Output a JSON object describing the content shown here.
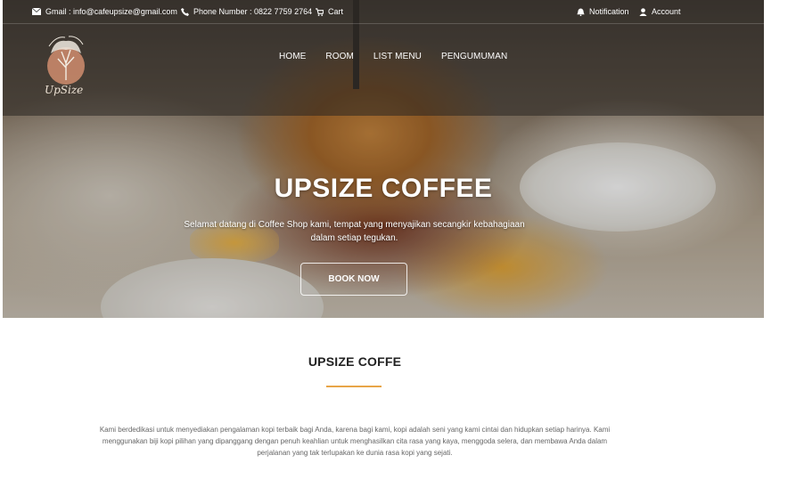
{
  "topbar": {
    "email": "Gmail : info@cafeupsize@gmail.com",
    "phone": "Phone Number : 0822 7759 2764",
    "cart": "Cart",
    "notification": "Notification",
    "account": "Account"
  },
  "icons": {
    "email": "envelope-icon",
    "phone": "phone-icon",
    "cart": "cart-icon",
    "notification": "bell-icon",
    "account": "user-icon"
  },
  "logo": {
    "text": "UpSize"
  },
  "nav": {
    "items": [
      {
        "label": "HOME"
      },
      {
        "label": "ROOM"
      },
      {
        "label": "LIST MENU"
      },
      {
        "label": "PENGUMUMAN"
      }
    ]
  },
  "hero": {
    "title": "UPSIZE COFFEE",
    "subtitle": "Selamat datang di Coffee Shop kami, tempat yang menyajikan secangkir kebahagiaan dalam setiap tegukan.",
    "button": "BOOK NOW"
  },
  "about": {
    "title": "UPSIZE COFFE",
    "text": "Kami berdedikasi untuk menyediakan pengalaman kopi terbaik bagi Anda, karena bagi kami, kopi adalah seni yang kami cintai dan hidupkan setiap harinya. Kami menggunakan biji kopi pilihan yang dipanggang dengan penuh keahlian untuk menghasilkan cita rasa yang kaya, menggoda selera, dan membawa Anda dalam perjalanan yang tak terlupakan ke dunia rasa kopi yang sejati.",
    "accent": "#e8a548"
  }
}
